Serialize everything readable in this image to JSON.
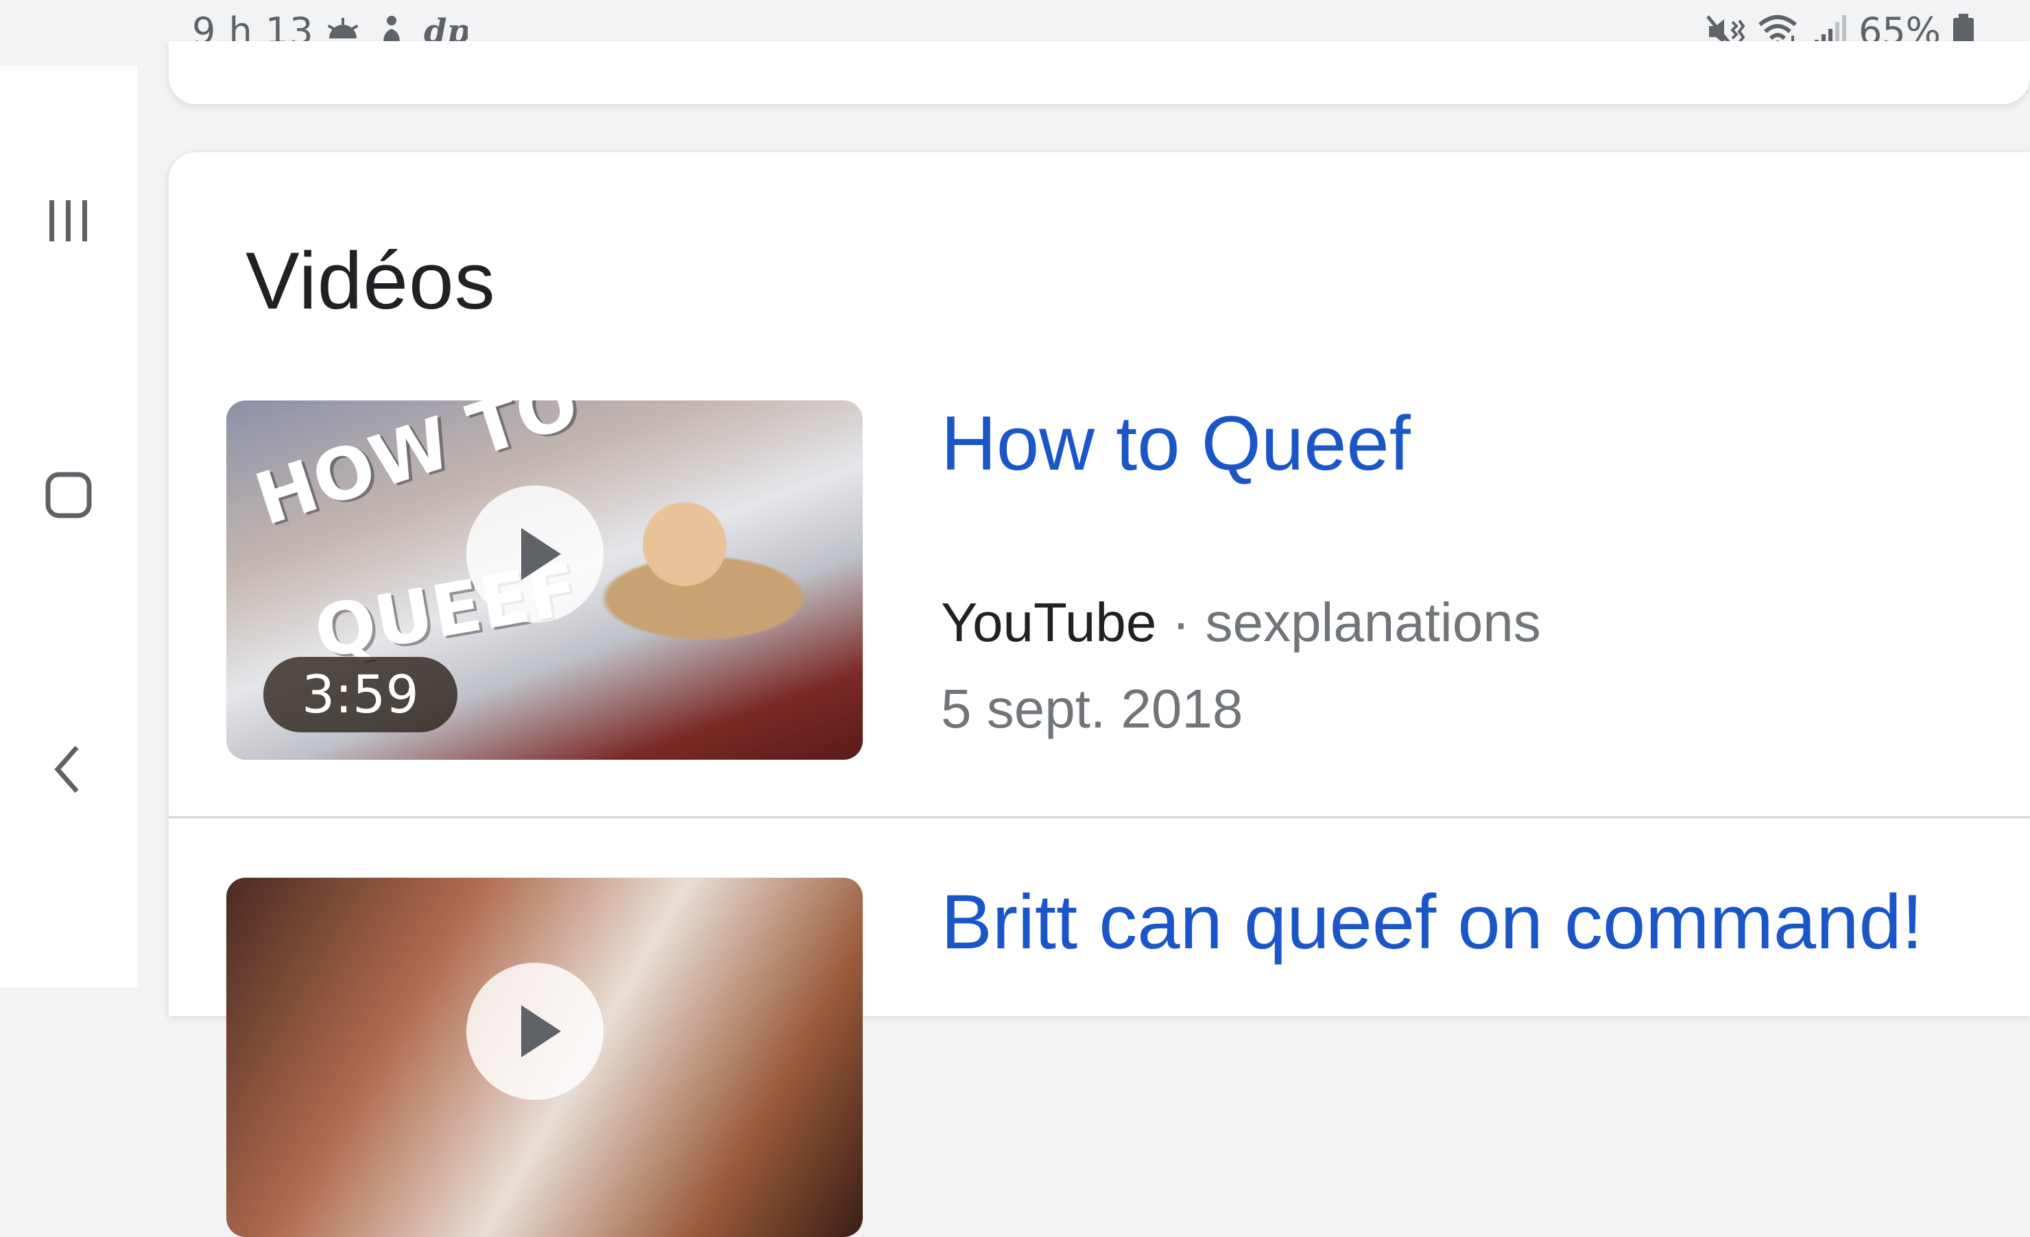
{
  "status_bar": {
    "time": "9 h 13",
    "battery_text": "65%",
    "icons": [
      "sunrise-icon",
      "yoga-icon",
      "dp-icon",
      "mute-vibrate-icon",
      "wifi-icon",
      "signal-icon",
      "battery-icon"
    ],
    "dp_glyph": "dp"
  },
  "nav": {
    "recent_apps": "recent-apps-icon",
    "home": "home-icon",
    "back": "back-icon"
  },
  "section": {
    "title": "Vidéos"
  },
  "videos": [
    {
      "title": "How to Queef",
      "source": "YouTube",
      "separator": " · ",
      "channel": "sexplanations",
      "date": "5 sept. 2018",
      "duration": "3:59",
      "thumb_text_1": "HOW TO",
      "thumb_text_2": "QUEEF"
    },
    {
      "title": "Britt can queef on command!"
    }
  ],
  "colors": {
    "link": "#1a56c7",
    "text": "#202124",
    "secondary": "#70757a"
  }
}
